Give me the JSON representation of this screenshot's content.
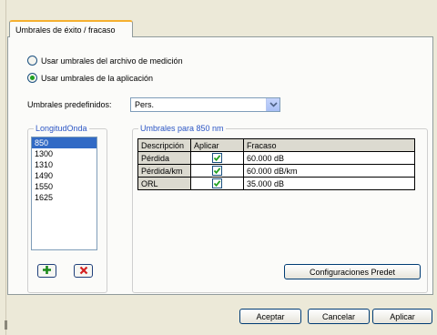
{
  "tab": {
    "label": "Umbrales de éxito / fracaso"
  },
  "source": {
    "options": [
      {
        "label": "Usar umbrales del archivo de medición",
        "checked": false
      },
      {
        "label": "Usar umbrales de la aplicación",
        "checked": true
      }
    ]
  },
  "preset": {
    "label": "Umbrales predefinidos:",
    "value": "Pers."
  },
  "wavelength": {
    "legend": "LongitudOnda",
    "items": [
      "850",
      "1300",
      "1310",
      "1490",
      "1550",
      "1625"
    ],
    "selected": "850"
  },
  "thresholds": {
    "legend": "Umbrales para 850 nm",
    "columns": [
      "Descripción",
      "Aplicar",
      "Fracaso"
    ],
    "rows": [
      {
        "description": "Pérdida",
        "apply": true,
        "fail": "60.000 dB"
      },
      {
        "description": "Pérdida/km",
        "apply": true,
        "fail": "60.000 dB/km"
      },
      {
        "description": "ORL",
        "apply": true,
        "fail": "35.000 dB"
      }
    ],
    "defaults_button": "Configuraciones Predet"
  },
  "icons": {
    "add": "plus-icon",
    "remove": "delete-x-icon",
    "dropdown": "chevron-down-icon"
  },
  "colors": {
    "add_icon": "#1c8a1c",
    "remove_icon": "#d42020",
    "legend": "#2c56c5",
    "tab_accent": "#f5b030",
    "selection": "#316ac5"
  },
  "footer": {
    "accept": "Aceptar",
    "cancel": "Cancelar",
    "apply": "Aplicar"
  }
}
